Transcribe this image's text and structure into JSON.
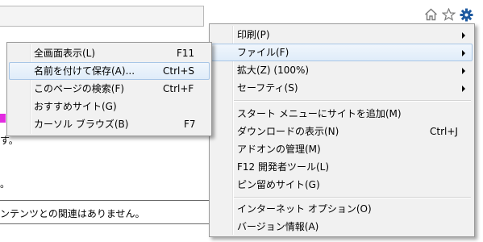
{
  "toolbar": {
    "icons": [
      "home-icon",
      "favorites-star-icon",
      "tools-gear-icon"
    ]
  },
  "background_text": {
    "line1": "す。",
    "line2": "。",
    "line3": "ンテンツとの関連はありません。"
  },
  "main_menu": {
    "items": [
      {
        "label": "印刷(P)",
        "has_submenu": true
      },
      {
        "label": "ファイル(F)",
        "has_submenu": true,
        "highlighted": true
      },
      {
        "label": "拡大(Z) (100%)",
        "has_submenu": true
      },
      {
        "label": "セーフティ(S)",
        "has_submenu": true
      },
      {
        "label": "スタート メニューにサイトを追加(M)"
      },
      {
        "label": "ダウンロードの表示(N)",
        "shortcut": "Ctrl+J"
      },
      {
        "label": "アドオンの管理(M)"
      },
      {
        "label": "F12 開発者ツール(L)"
      },
      {
        "label": "ピン留めサイト(G)"
      },
      {
        "label": "インターネット オプション(O)"
      },
      {
        "label": "バージョン情報(A)"
      }
    ]
  },
  "file_submenu": {
    "items": [
      {
        "label": "全画面表示(L)",
        "shortcut": "F11"
      },
      {
        "label": "名前を付けて保存(A)...",
        "shortcut": "Ctrl+S",
        "highlighted": true
      },
      {
        "label": "このページの検索(F)",
        "shortcut": "Ctrl+F"
      },
      {
        "label": "おすすめサイト(G)"
      },
      {
        "label": "カーソル ブラウズ(B)",
        "shortcut": "F7"
      }
    ]
  },
  "colors": {
    "highlight_border": "#a8c6e6",
    "menu_background": "#f1f1f1",
    "gear_icon": "#1e5aa0",
    "pink_marker": "#e22be0"
  }
}
